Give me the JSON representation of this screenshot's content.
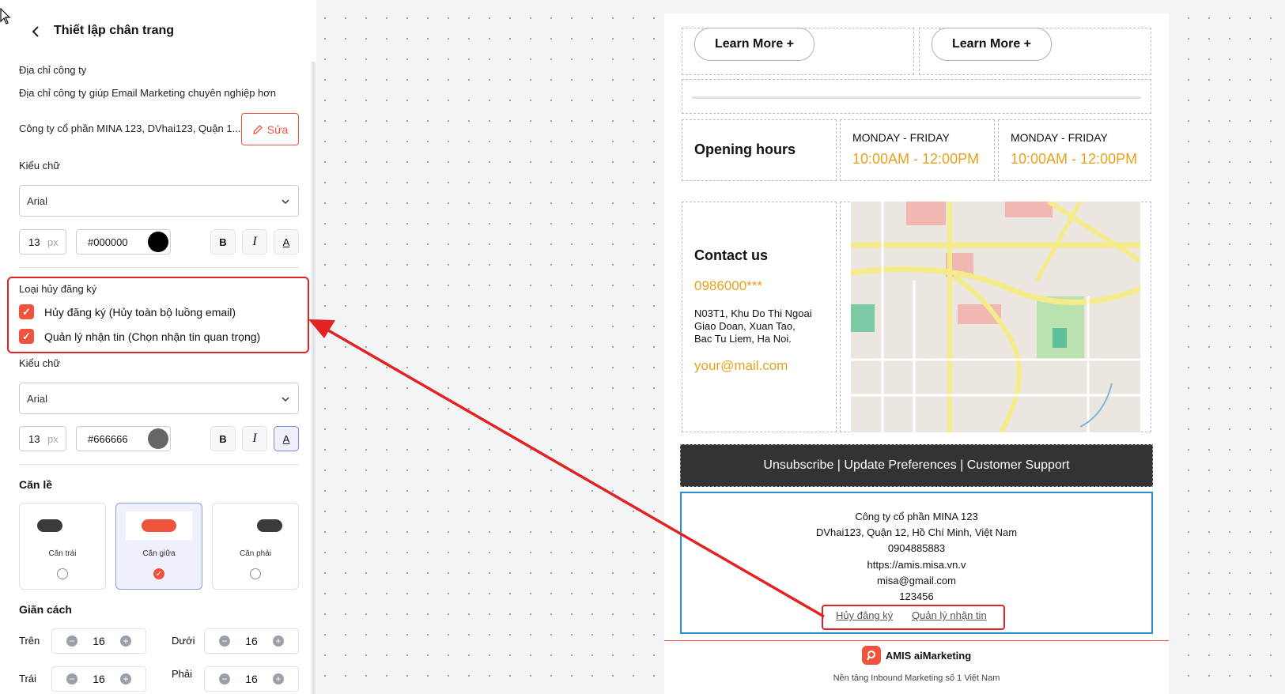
{
  "panel": {
    "title": "Thiết lập chân trang",
    "address_label": "Địa chỉ công ty",
    "address_hint": "Địa chỉ công ty giúp Email Marketing chuyên nghiệp hơn",
    "address_value": "Công ty cổ phần MINA 123, DVhai123, Quận 1...",
    "edit_button": "Sửa",
    "font1": {
      "label": "Kiểu chữ",
      "family": "Arial",
      "size": "13",
      "unit": "px",
      "color_text": "#000000",
      "color": "#000000"
    },
    "unsub": {
      "label": "Loại hủy đăng ký",
      "options": [
        {
          "label": "Hủy đăng ký (Hủy toàn bộ luồng email)"
        },
        {
          "label": "Quản lý nhận tin (Chọn nhận tin quan trọng)"
        }
      ]
    },
    "font2": {
      "label": "Kiểu chữ",
      "family": "Arial",
      "size": "13",
      "unit": "px",
      "color_text": "#666666",
      "color": "#666666"
    },
    "align": {
      "label": "Căn lề",
      "left": "Căn trái",
      "center": "Căn giữa",
      "right": "Căn phải",
      "selected": "center"
    },
    "spacing": {
      "label": "Giãn cách",
      "top_label": "Trên",
      "top": "16",
      "bottom_label": "Dưới",
      "bottom": "16",
      "left_label": "Trái",
      "left": "16",
      "right_label": "Phải",
      "right": "16"
    },
    "bold_glyph": "B",
    "italic_glyph": "I",
    "underline_glyph": "A"
  },
  "email": {
    "learn_more_1": "Learn More +",
    "learn_more_2": "Learn More +",
    "opening_hours": "Opening hours",
    "day_range_1": "MONDAY - FRIDAY",
    "time_1": "10:00AM - 12:00PM",
    "day_range_2": "MONDAY - FRIDAY",
    "time_2": "10:00AM - 12:00PM",
    "contact_title": "Contact us",
    "contact_phone": "0986000***",
    "contact_address": [
      "N03T1, Khu Do Thi Ngoai",
      "Giao Doan, Xuan Tao,",
      "Bac Tu Liem, Ha Noi."
    ],
    "contact_email": "your@mail.com",
    "footer_bar": "Unsubscribe | Update Preferences | Customer Support",
    "company_lines": [
      "Công ty cổ phần MINA 123",
      "DVhai123, Quận 12, Hồ Chí Minh, Việt Nam",
      "0904885883",
      "https://amis.misa.vn.v",
      "misa@gmail.com",
      "123456"
    ],
    "unsub_link": "Hủy đăng ký",
    "manage_link": "Quản lý nhận tin",
    "brand": "AMIS aiMarketing",
    "brand_tagline": "Nền tảng Inbound Marketing số 1 Việt Nam"
  },
  "colors": {
    "accent": "#f0533c",
    "highlight": "#e32222",
    "orange": "#e8a21c",
    "dark_bar": "#333333",
    "selection_blue": "#2b8fd6"
  },
  "icons": [
    "cursor-icon",
    "back-chevron-icon",
    "pencil-icon",
    "chevron-down-icon",
    "check-icon",
    "minus-icon",
    "plus-icon",
    "amis-logo-icon"
  ]
}
